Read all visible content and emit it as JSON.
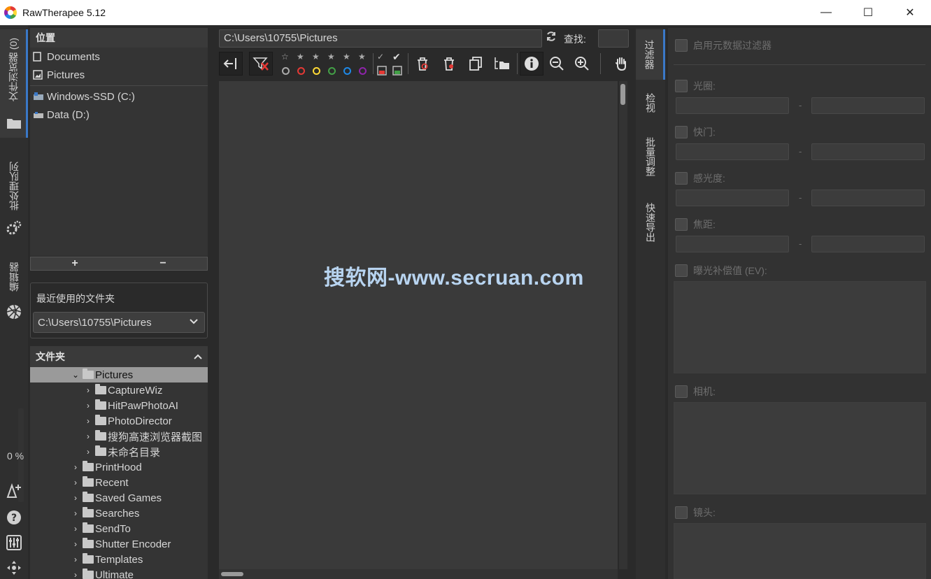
{
  "window": {
    "title": "RawTherapee 5.12",
    "min": "—",
    "max": "☐",
    "close": "✕"
  },
  "left_tabs": {
    "file_browser": "文件浏览器 (0)",
    "queue": "批处理队列",
    "editor": "编辑器",
    "progress": "0 %"
  },
  "places": {
    "title": "位置",
    "items": [
      "Documents",
      "Pictures"
    ],
    "drives": [
      "Windows-SSD (C:)",
      "Data (D:)"
    ],
    "add": "+",
    "remove": "−"
  },
  "recent": {
    "title": "最近使用的文件夹",
    "selected": "C:\\Users\\10755\\Pictures"
  },
  "tree": {
    "title": "文件夹",
    "selected": "Pictures",
    "children": [
      "CaptureWiz",
      "HitPawPhotoAI",
      "PhotoDirector",
      "搜狗高速浏览器截图",
      "未命名目录"
    ],
    "siblings": [
      "PrintHood",
      "Recent",
      "Saved Games",
      "Searches",
      "SendTo",
      "Shutter Encoder",
      "Templates",
      "Ultimate"
    ]
  },
  "browser": {
    "path": "C:\\Users\\10755\\Pictures",
    "search_label": "查找:",
    "watermark": "搜软网-www.secruan.com"
  },
  "right_tabs": [
    "过滤器",
    "检视",
    "批量调整",
    "快速导出"
  ],
  "filters": {
    "enable_meta": "启用元数据过滤器",
    "aperture": "光圈:",
    "shutter": "快门:",
    "iso": "感光度:",
    "focal": "焦距:",
    "ev": "曝光补偿值 (EV):",
    "camera": "相机:",
    "lens": "镜头:",
    "dash": "-"
  }
}
